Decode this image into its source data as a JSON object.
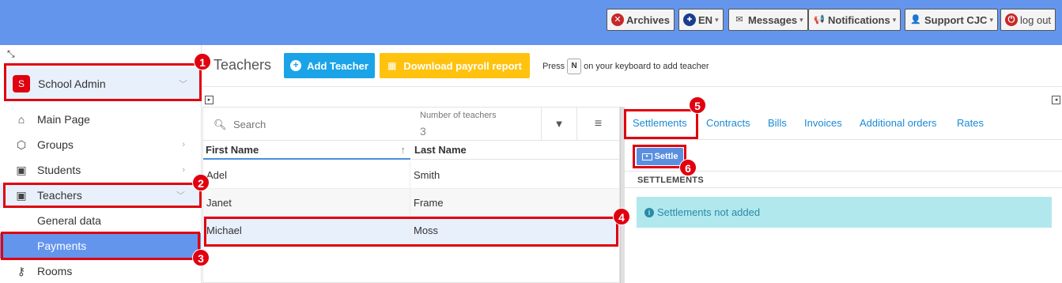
{
  "topbar": {
    "archives": "Archives",
    "language": "EN",
    "messages": "Messages",
    "notifications": "Notifications",
    "support": "Support CJC",
    "logout": "log out"
  },
  "sidebar": {
    "school_initial": "S",
    "school_name": "School Admin",
    "items": [
      {
        "label": "Main Page"
      },
      {
        "label": "Groups"
      },
      {
        "label": "Students"
      },
      {
        "label": "Teachers"
      },
      {
        "label": "General data"
      },
      {
        "label": "Payments"
      },
      {
        "label": "Rooms"
      }
    ]
  },
  "header": {
    "title": "Teachers",
    "add_teacher": "Add Teacher",
    "download_payroll": "Download payroll report",
    "hint_prefix": "Press",
    "hint_key": "N",
    "hint_suffix": "on your keyboard to add teacher"
  },
  "table": {
    "search_placeholder": "Search",
    "count_label": "Number of teachers",
    "count_value": "3",
    "col_first": "First Name",
    "col_last": "Last Name",
    "rows": [
      {
        "first": "Adel",
        "last": "Smith"
      },
      {
        "first": "Janet",
        "last": "Frame"
      },
      {
        "first": "Michael",
        "last": "Moss"
      }
    ]
  },
  "panel": {
    "tabs": [
      "Settlements",
      "Contracts",
      "Bills",
      "Invoices",
      "Additional orders",
      "Rates"
    ],
    "settle_button": "Settle",
    "section_title": "SETTLEMENTS",
    "empty_message": "Settlements not added"
  },
  "annotations": [
    "1",
    "2",
    "3",
    "4",
    "5",
    "6"
  ],
  "colors": {
    "topbar": "#6495ed",
    "active_nav": "#6495ed",
    "add_button": "#1ba3e8",
    "download_button": "#ffc20e",
    "annotation": "#e0000f",
    "alert_bg": "#b1e8ee"
  }
}
